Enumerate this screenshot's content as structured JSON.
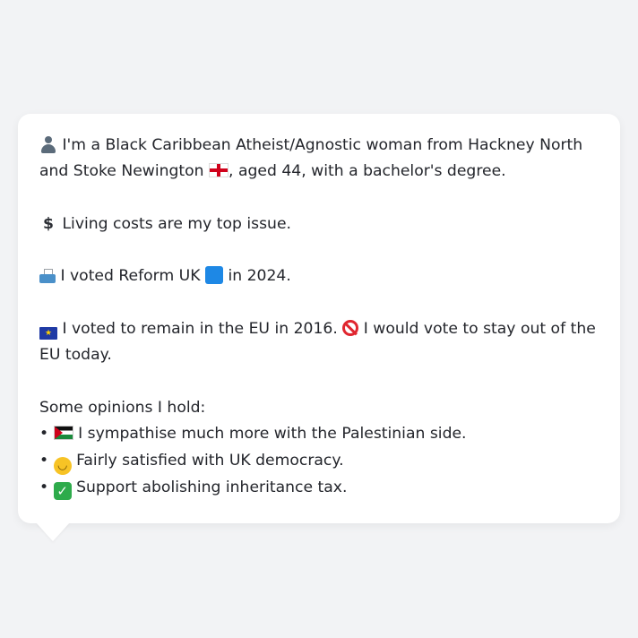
{
  "profile": {
    "intro_line": "I'm a Black Caribbean Atheist/Agnostic woman from Hackney North and Stoke Newington",
    "intro_tail": ", aged 44, with a bachelor's degree.",
    "top_issue": "Living costs are my top issue.",
    "vote_2024_prefix": "I voted Reform UK",
    "vote_2024_suffix": "in 2024.",
    "eu_2016": "I voted to remain in the EU in 2016.",
    "eu_today": "I would vote to stay out of the EU today.",
    "opinions_heading": "Some opinions I hold:",
    "opinions": [
      "I sympathise much more with the Palestinian side.",
      "Fairly satisfied with UK democracy.",
      "Support abolishing inheritance tax."
    ]
  },
  "icons": {
    "intro": "person-icon",
    "location_flag": "england-flag-icon",
    "top_issue": "dollar-icon",
    "vote": "ballot-box-icon",
    "party_color": "#1e88e5",
    "eu": "eu-flag-icon",
    "eu_today": "prohibited-icon",
    "opinion_1": "palestine-flag-icon",
    "opinion_2": "slight-smile-icon",
    "opinion_3": "check-mark-icon"
  }
}
